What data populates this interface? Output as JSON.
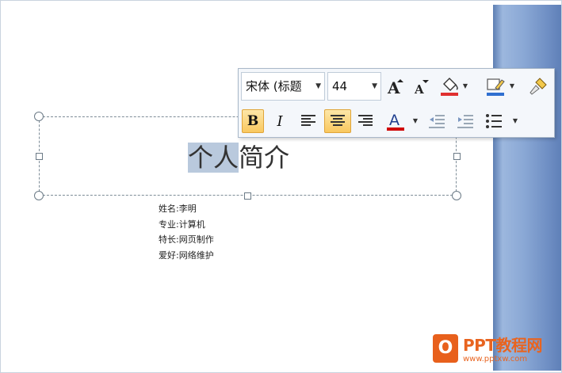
{
  "slide": {
    "title_selected": "个人",
    "title_rest": "简介",
    "info_lines": [
      "姓名:李明",
      "专业:计算机",
      "特长:网页制作",
      "爱好:网络维护"
    ]
  },
  "mini_toolbar": {
    "font_name": "宋体 (标题",
    "font_size": "44",
    "grow_font_icon": "grow-font-icon",
    "shrink_font_icon": "shrink-font-icon",
    "highlight_icon": "paint-bucket-icon",
    "pen_icon": "line-color-icon",
    "format_painter_icon": "format-painter-icon",
    "bold_label": "B",
    "italic_label": "I",
    "font_color_label": "A",
    "colors": {
      "fill_accent": "#e03030",
      "line_accent": "#2f6fd0",
      "font_color": "#d00000",
      "active_button": "#f9c85f"
    }
  },
  "watermark": {
    "badge": "O",
    "main": "PPT教程网",
    "url": "www.pptxw.com"
  }
}
